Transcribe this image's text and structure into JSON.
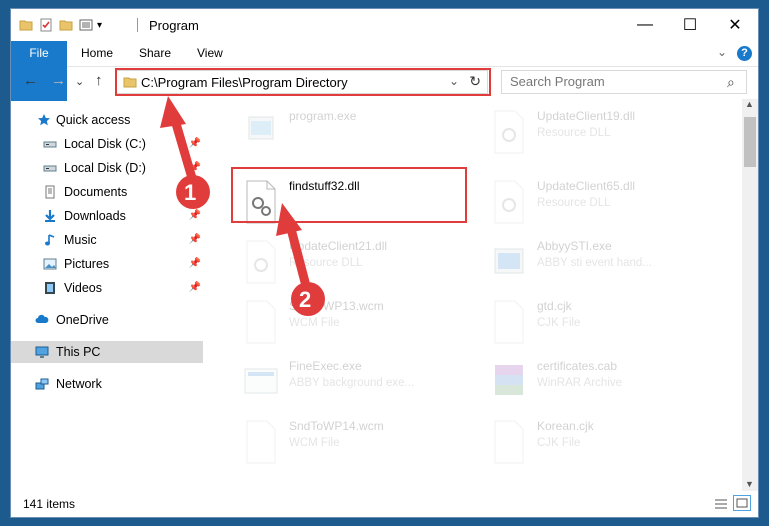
{
  "window": {
    "title": "Program",
    "minimize_label": "—",
    "maximize_label": "☐",
    "close_label": "✕"
  },
  "ribbon": {
    "file": "File",
    "home": "Home",
    "share": "Share",
    "view": "View",
    "help": "?",
    "collapse": "⌄"
  },
  "nav": {
    "back": "←",
    "forward": "→",
    "recent": "⌄",
    "up": "↑",
    "address": "C:\\Program Files\\Program Directory",
    "refresh": "↻",
    "search_placeholder": "Search Program",
    "search_icon": "⌕"
  },
  "sidebar": {
    "items": [
      {
        "label": "Quick access",
        "icon": "star-icon"
      },
      {
        "label": "Local Disk (C:)",
        "icon": "drive-icon"
      },
      {
        "label": "Local Disk (D:)",
        "icon": "drive-icon"
      },
      {
        "label": "Documents",
        "icon": "documents-icon"
      },
      {
        "label": "Downloads",
        "icon": "downloads-icon"
      },
      {
        "label": "Music",
        "icon": "music-icon"
      },
      {
        "label": "Pictures",
        "icon": "pictures-icon"
      },
      {
        "label": "Videos",
        "icon": "videos-icon"
      },
      {
        "label": "OneDrive",
        "icon": "cloud-icon"
      },
      {
        "label": "This PC",
        "icon": "computer-icon"
      },
      {
        "label": "Network",
        "icon": "network-icon"
      }
    ]
  },
  "files": [
    {
      "name": "program.exe",
      "type": ""
    },
    {
      "name": "UpdateClient19.dll",
      "type": "Resource DLL"
    },
    {
      "name": "findstuff32.dll",
      "type": ""
    },
    {
      "name": "UpdateClient65.dll",
      "type": "Resource DLL"
    },
    {
      "name": "UpdateClient21.dll",
      "type": "Resource DLL"
    },
    {
      "name": "AbbyySTI.exe",
      "type": "ABBY sti event hand..."
    },
    {
      "name": "SndToWP13.wcm",
      "type": "WCM File"
    },
    {
      "name": "gtd.cjk",
      "type": "CJK File"
    },
    {
      "name": "FineExec.exe",
      "type": "ABBY background exe..."
    },
    {
      "name": "certificates.cab",
      "type": "WinRAR Archive"
    },
    {
      "name": "SndToWP14.wcm",
      "type": "WCM File"
    },
    {
      "name": "Korean.cjk",
      "type": "CJK File"
    }
  ],
  "annotations": {
    "step1": "1",
    "step2": "2"
  },
  "status": {
    "count": "141 items"
  },
  "colors": {
    "accent": "#1979ca",
    "highlight": "#e03c3c",
    "desktop": "#1d5b8f"
  }
}
